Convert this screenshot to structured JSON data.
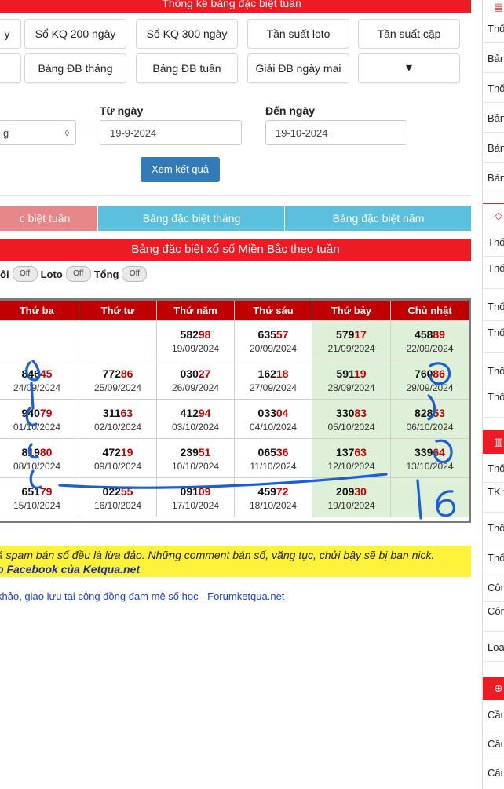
{
  "header": {
    "title": "Thống kê bảng đặc biệt tuần"
  },
  "nav": {
    "row1": [
      "y",
      "Sổ KQ 200 ngày",
      "Sổ KQ 300 ngày",
      "Tần suất loto",
      "Tần suất cặp"
    ],
    "row2": [
      "",
      "Bảng ĐB tháng",
      "Bảng ĐB tuần",
      "Giải ĐB ngày mai",
      "▾"
    ]
  },
  "form": {
    "from_label": "Từ ngày",
    "to_label": "Đến ngày",
    "select_value": "g",
    "from_value": "19-9-2024",
    "to_value": "19-10-2024",
    "submit_label": "Xem kết quả"
  },
  "tabs": [
    "c biệt tuần",
    "Bảng đặc biệt tháng",
    "Bảng đặc biệt năm"
  ],
  "banner": "Bảng đặc biệt xổ số Miền Bắc theo tuần",
  "toggles": {
    "l1": "ôi",
    "l2": "Loto",
    "l3": "Tổng",
    "state": "Off"
  },
  "table": {
    "headers": [
      "Thứ ba",
      "Thứ tư",
      "Thứ năm",
      "Thứ sáu",
      "Thứ bảy",
      "Chủ nhật"
    ],
    "rows": [
      [
        null,
        null,
        {
          "h": "582",
          "t": "98",
          "d": "19/09/2024"
        },
        {
          "h": "635",
          "t": "57",
          "d": "20/09/2024"
        },
        {
          "h": "579",
          "t": "17",
          "d": "21/09/2024"
        },
        {
          "h": "458",
          "t": "89",
          "d": "22/09/2024"
        }
      ],
      [
        {
          "h": "846",
          "t": "45",
          "d": "24/09/2024"
        },
        {
          "h": "772",
          "t": "86",
          "d": "25/09/2024"
        },
        {
          "h": "030",
          "t": "27",
          "d": "26/09/2024"
        },
        {
          "h": "162",
          "t": "18",
          "d": "27/09/2024"
        },
        {
          "h": "591",
          "t": "19",
          "d": "28/09/2024"
        },
        {
          "h": "760",
          "t": "86",
          "d": "29/09/2024"
        }
      ],
      [
        {
          "h": "940",
          "t": "79",
          "d": "01/10/2024"
        },
        {
          "h": "311",
          "t": "63",
          "d": "02/10/2024"
        },
        {
          "h": "412",
          "t": "94",
          "d": "03/10/2024"
        },
        {
          "h": "033",
          "t": "04",
          "d": "04/10/2024"
        },
        {
          "h": "330",
          "t": "83",
          "d": "05/10/2024"
        },
        {
          "h": "828",
          "t": "53",
          "d": "06/10/2024"
        }
      ],
      [
        {
          "h": "819",
          "t": "80",
          "d": "08/10/2024"
        },
        {
          "h": "472",
          "t": "19",
          "d": "09/10/2024"
        },
        {
          "h": "239",
          "t": "51",
          "d": "10/10/2024"
        },
        {
          "h": "065",
          "t": "36",
          "d": "11/10/2024"
        },
        {
          "h": "137",
          "t": "63",
          "d": "12/10/2024"
        },
        {
          "h": "339",
          "t": "64",
          "d": "13/10/2024"
        }
      ],
      [
        {
          "h": "651",
          "t": "79",
          "d": "15/10/2024"
        },
        {
          "h": "022",
          "t": "55",
          "d": "16/10/2024"
        },
        {
          "h": "091",
          "t": "09",
          "d": "17/10/2024"
        },
        {
          "h": "459",
          "t": "72",
          "d": "18/10/2024"
        },
        {
          "h": "209",
          "t": "30",
          "d": "19/10/2024"
        },
        null
      ]
    ]
  },
  "notice": {
    "line1": "á spam bán số đều là lừa đảo. Những comment bán số, văng tục, chửi bậy sẽ bị ban nick.",
    "line2": "o Facebook của Ketqua.net"
  },
  "footer_link": "khảo, giao lưu tại cộng đồng đam mê số học - Forumketqua.net",
  "sidebar": {
    "heads": [
      "▤",
      "◇",
      "▥",
      "⊕"
    ],
    "group1": [
      "Thố",
      "Bản",
      "Thố",
      "Bản",
      "Bản",
      "Bản"
    ],
    "group2": [
      "Thố",
      "Thố loto",
      "Thố",
      "Thố loto",
      "Thố",
      "Thố theo"
    ],
    "group3": [
      "Thố",
      "TK t",
      "Thố",
      "Thố",
      "Côn",
      "Côn VIP",
      "Loạ"
    ],
    "group4": [
      "Cầu",
      "Cầu",
      "Cầu"
    ]
  },
  "handwriting": {
    "note": "16"
  },
  "colors": {
    "red": "#ed1c24",
    "dark_red": "#c00000",
    "tab_blue": "#5bc0de",
    "tab_active": "#e8878a",
    "weekend": "#dff0d8",
    "button": "#337ab7"
  }
}
